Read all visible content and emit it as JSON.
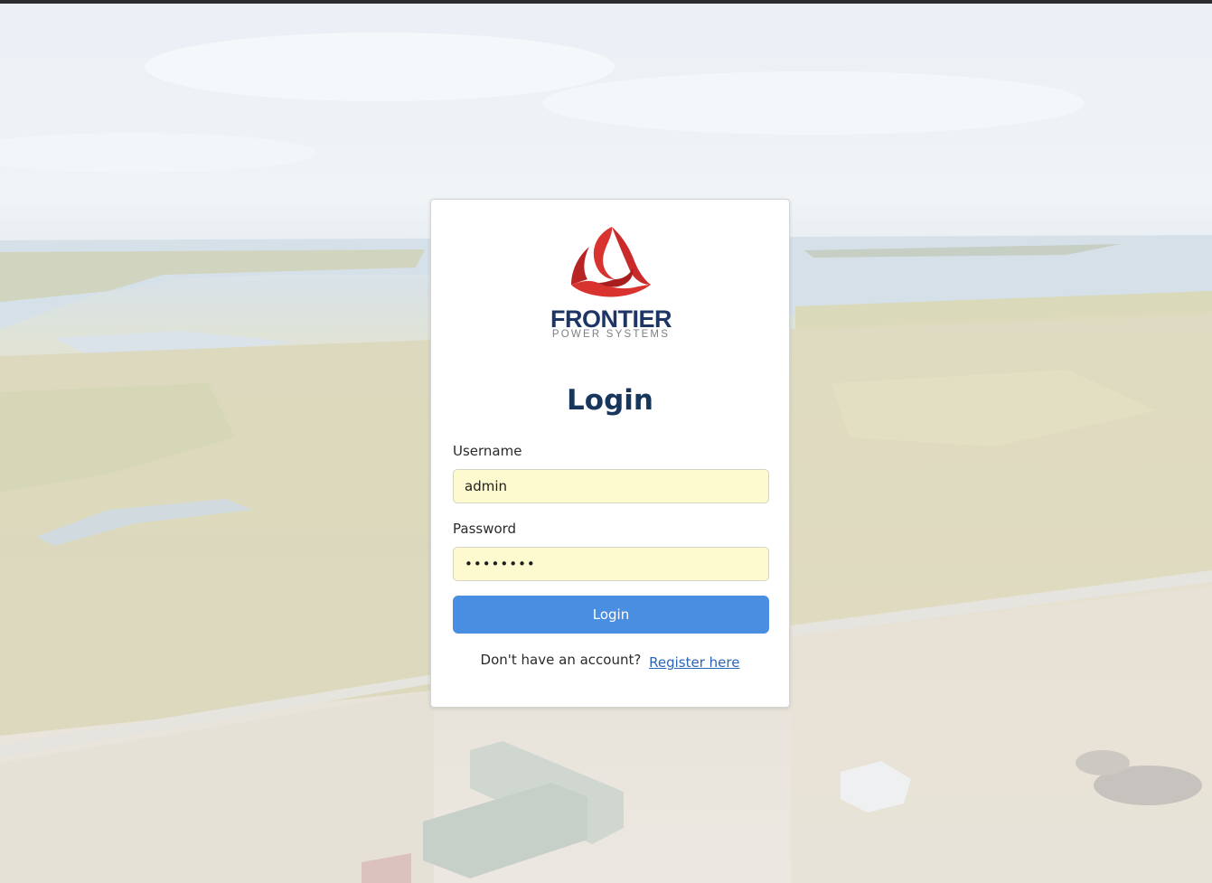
{
  "brand": {
    "name": "FRONTIER",
    "tagline": "POWER SYSTEMS",
    "logo_icon": "trefoil-logo-icon",
    "colors": {
      "logo_red": "#d8332f",
      "navy": "#1e3566",
      "tagline_gray": "#7d7f85"
    }
  },
  "login_form": {
    "title": "Login",
    "username": {
      "label": "Username",
      "value": "admin"
    },
    "password": {
      "label": "Password",
      "value": "••••••••"
    },
    "submit_label": "Login",
    "register_prompt": "Don't have an account?",
    "register_link_label": "Register here"
  },
  "theme": {
    "button_color": "#4a8ee2",
    "autofill_bg": "#fdfacf",
    "title_color": "#17365c",
    "link_color": "#2a66b8"
  }
}
